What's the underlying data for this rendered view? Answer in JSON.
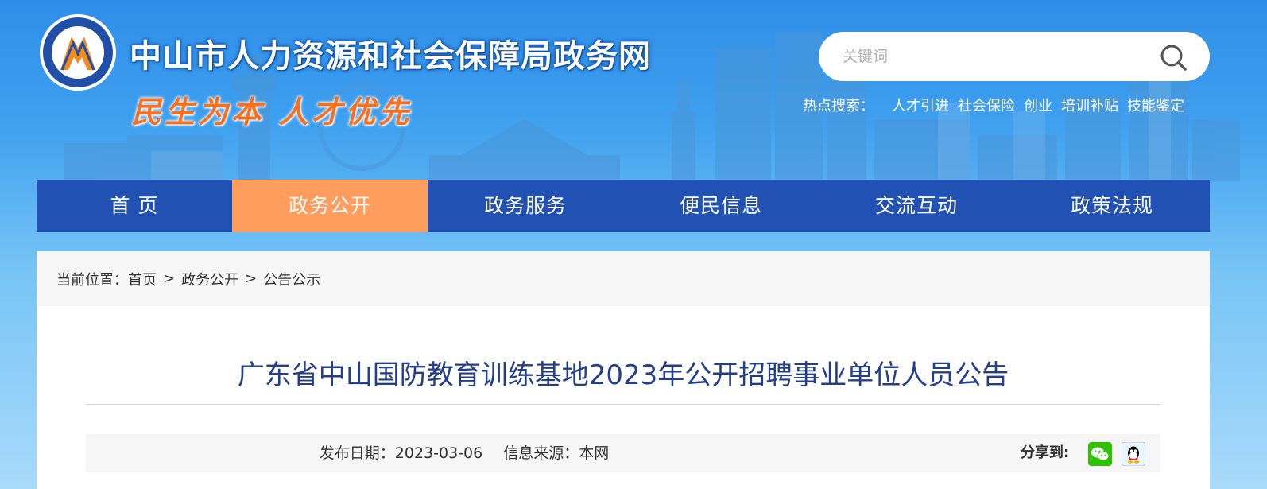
{
  "header": {
    "site_title": "中山市人力资源和社会保障局政务网",
    "slogan": "民生为本 人才优先",
    "logo_icon": "emblem-logo"
  },
  "search": {
    "placeholder": "关键词",
    "icon": "search-icon"
  },
  "hot_search": {
    "label": "热点搜索：",
    "links": [
      "人才引进",
      "社会保险",
      "创业",
      "培训补贴",
      "技能鉴定"
    ]
  },
  "nav": {
    "items": [
      "首 页",
      "政务公开",
      "政务服务",
      "便民信息",
      "交流互动",
      "政策法规"
    ],
    "active_index": 1
  },
  "breadcrumb": {
    "label": "当前位置：",
    "items": [
      "首页",
      "政务公开",
      "公告公示"
    ],
    "separator": ">"
  },
  "article": {
    "title": "广东省中山国防教育训练基地2023年公开招聘事业单位人员公告",
    "date_label": "发布日期：",
    "date": "2023-03-06",
    "source_label": "信息来源：",
    "source": "本网"
  },
  "share": {
    "label": "分享到:",
    "icons": [
      "wechat-icon",
      "qq-icon"
    ]
  },
  "colors": {
    "nav_bg": "#2151b2",
    "nav_active": "#ff9d5e",
    "title_color": "#233e8b",
    "slogan_color": "#f6701f"
  }
}
